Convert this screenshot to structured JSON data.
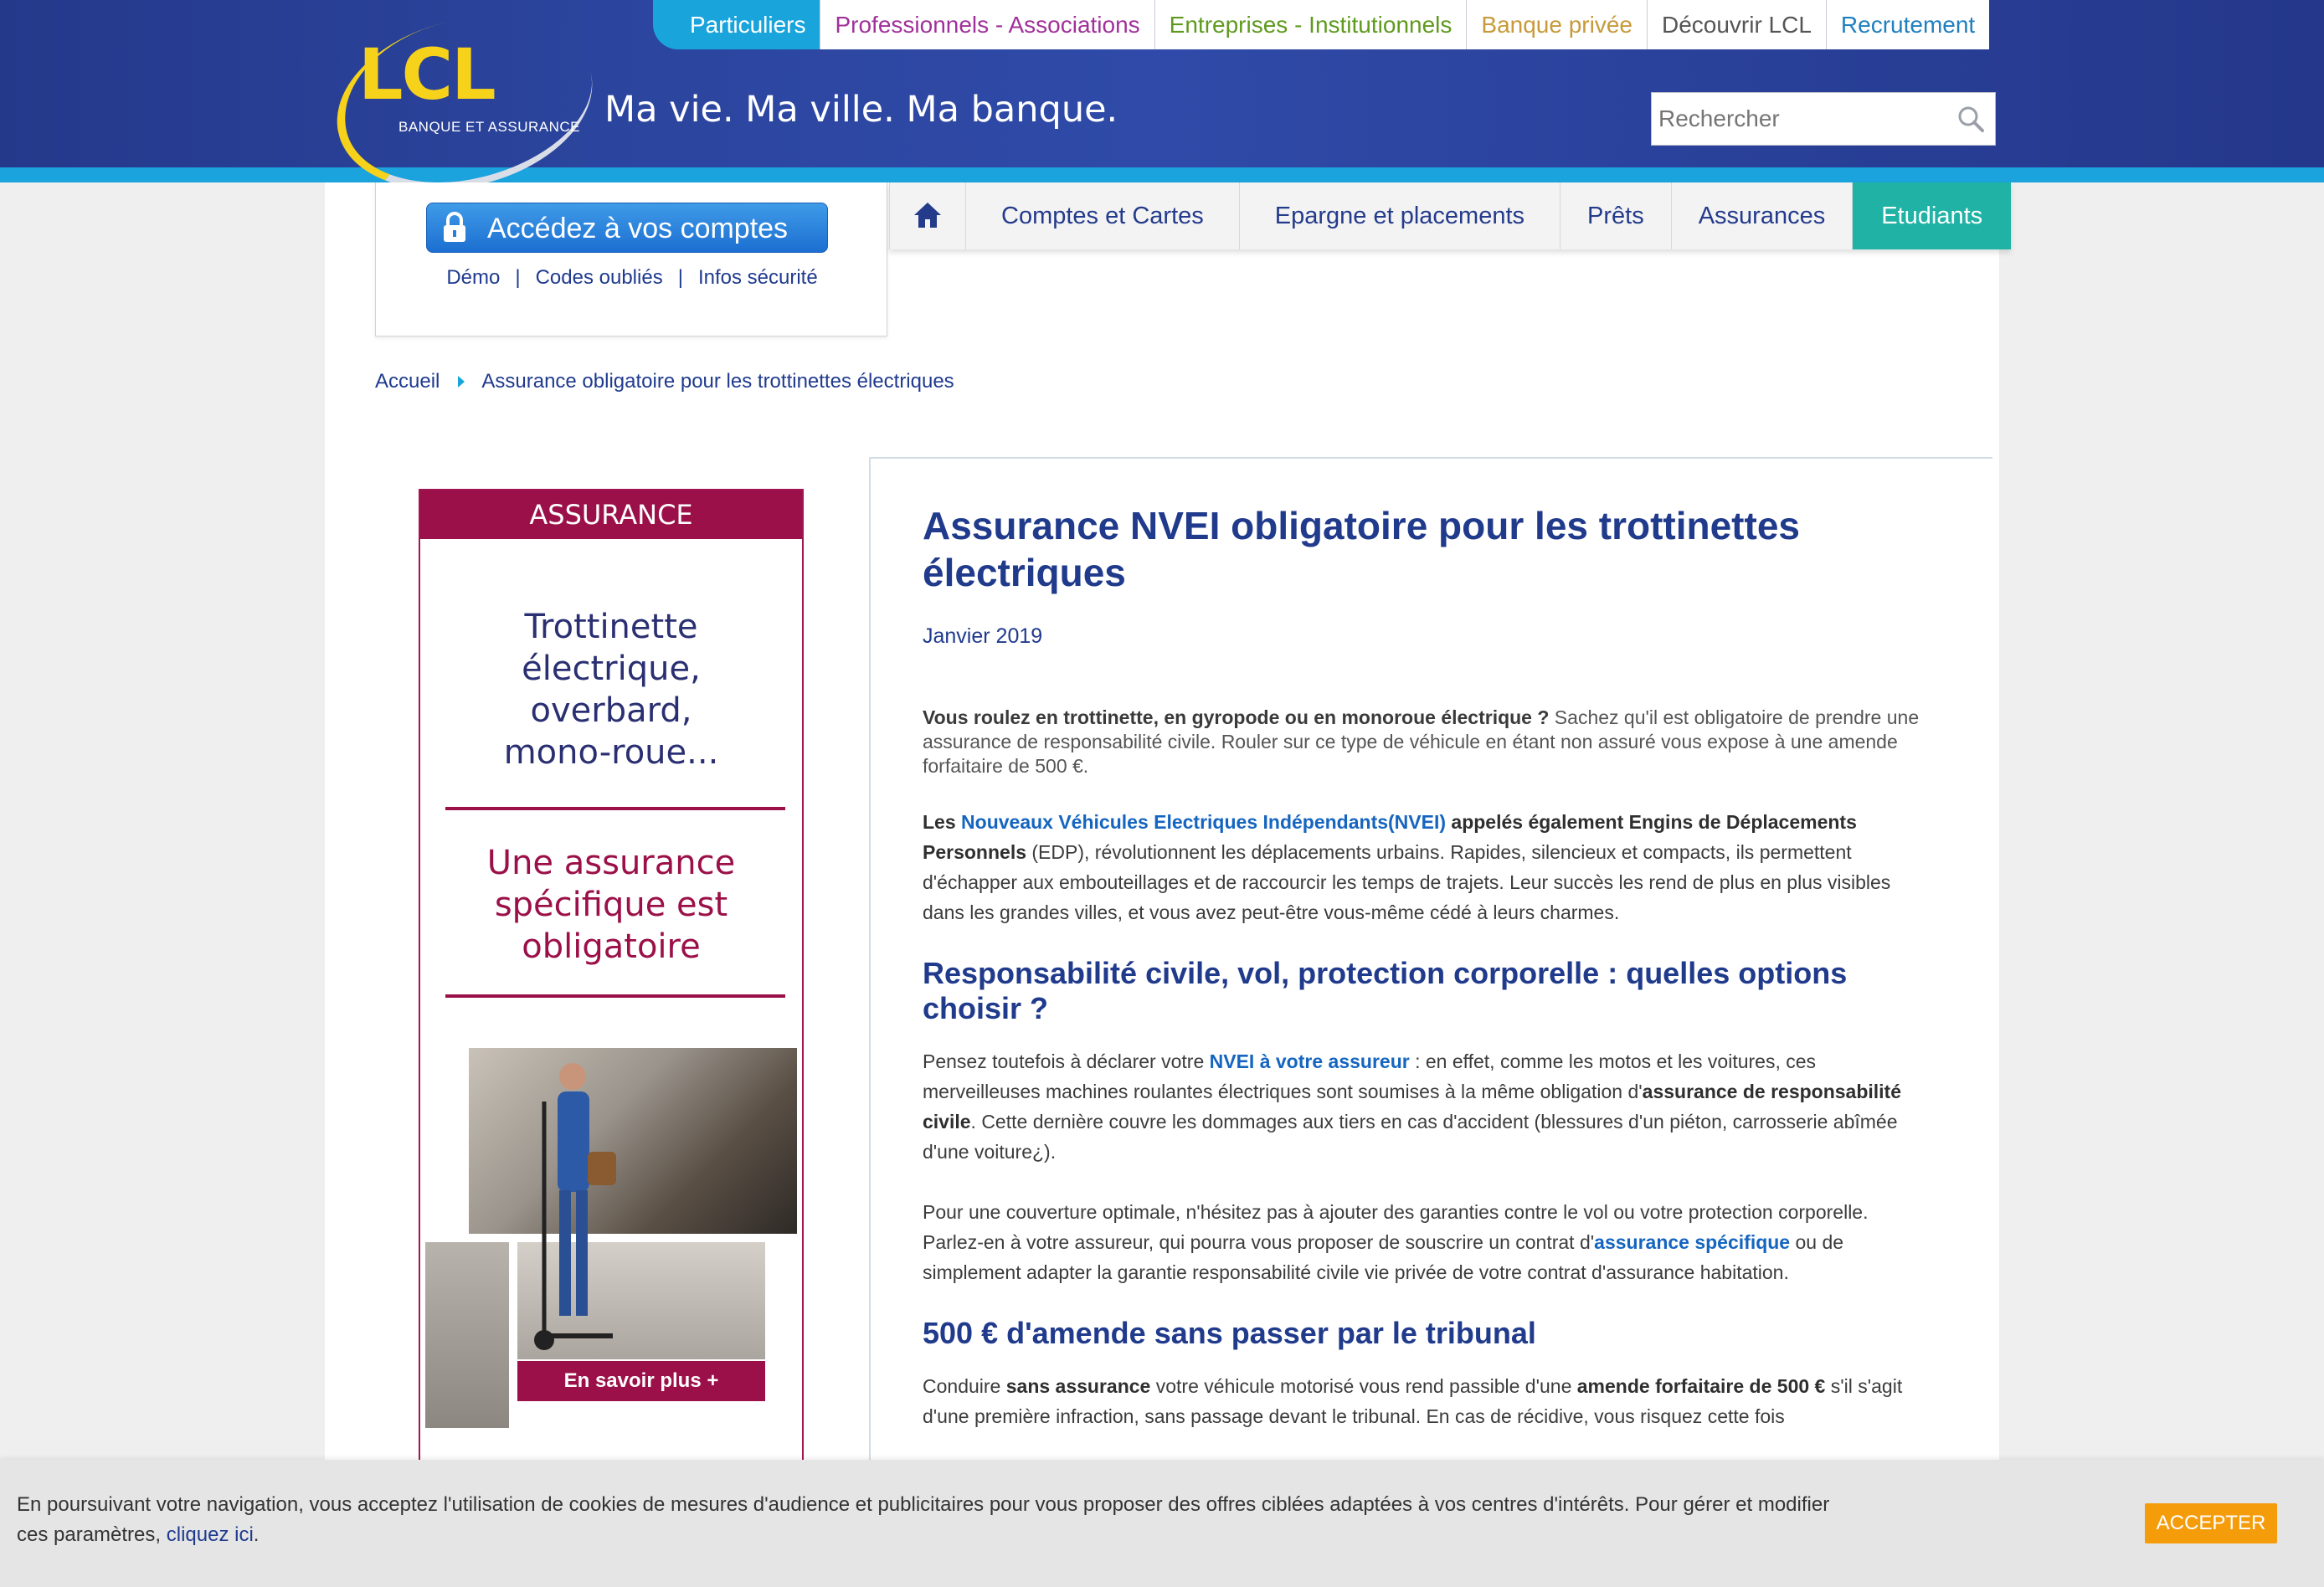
{
  "brand": {
    "logo_text": "LCL",
    "logo_sub": "BANQUE ET ASSURANCE",
    "tagline": "Ma vie. Ma ville. Ma banque.",
    "accent": "#19a4dc",
    "header_blue": "#2c46a0"
  },
  "topnav": [
    {
      "label": "Particuliers",
      "color": "#ffffff"
    },
    {
      "label": "Professionnels - Associations",
      "color": "#a0319a"
    },
    {
      "label": "Entreprises - Institutionnels",
      "color": "#5f9a1f"
    },
    {
      "label": "Banque privée",
      "color": "#c79a3a"
    },
    {
      "label": "Découvrir LCL",
      "color": "#555555"
    },
    {
      "label": "Recrutement",
      "color": "#1f7fbf"
    }
  ],
  "search": {
    "placeholder": "Rechercher",
    "icon": "search-icon"
  },
  "login": {
    "button": "Accédez à vos comptes",
    "icon": "lock-icon",
    "links": [
      "Démo",
      "Codes oubliés",
      "Infos sécurité"
    ]
  },
  "mainnav": {
    "home_icon": "home-icon",
    "items": [
      "Comptes et Cartes",
      "Epargne et placements",
      "Prêts",
      "Assurances",
      "Etudiants"
    ],
    "active": "Etudiants",
    "active_color": "#20b2a5"
  },
  "breadcrumb": [
    "Accueil",
    "Assurance obligatoire pour les trottinettes électriques"
  ],
  "ad": {
    "header": "ASSURANCE",
    "title_lines": [
      "Trottinette",
      "électrique,",
      "overbard,",
      "mono-roue..."
    ],
    "subtitle_lines": [
      "Une assurance",
      "spécifique est",
      "obligatoire"
    ],
    "cta": "En savoir plus +",
    "color": "#9b1048"
  },
  "article": {
    "title": "Assurance NVEI obligatoire pour les trottinettes électriques",
    "date": "Janvier 2019",
    "intro_bold": "Vous roulez en trottinette, en gyropode ou en monoroue électrique ?",
    "intro_rest": " Sachez qu'il est obligatoire de prendre une assurance de responsabilité civile. Rouler sur ce type de véhicule en étant non assuré vous expose à une amende forfaitaire de 500 €.",
    "p1_a": "Les ",
    "p1_link": "Nouveaux Véhicules Electriques Indépendants(NVEI)",
    "p1_bold": " appelés également Engins de Déplacements Personnels",
    "p1_rest": " (EDP), révolutionnent les déplacements urbains. Rapides, silencieux et compacts, ils permettent d'échapper aux embouteillages et de raccourcir les temps de trajets. Leur succès les rend de plus en plus visibles dans les grandes villes, et vous avez peut-être vous-même cédé à leurs charmes.",
    "h2_1": "Responsabilité civile, vol, protection corporelle : quelles options choisir ?",
    "p2_a": "Pensez toutefois à déclarer votre ",
    "p2_link": "NVEI à votre assureur",
    "p2_b": " : en effet, comme les motos et les voitures, ces merveilleuses machines roulantes électriques sont soumises à la même obligation d'",
    "p2_bold": "assurance de responsabilité civile",
    "p2_c": ". Cette dernière couvre les dommages aux tiers en cas d'accident (blessures d'un piéton, carrosserie abîmée d'une voiture¿).",
    "p3_a": "Pour une couverture optimale, n'hésitez pas à ajouter des garanties contre le vol ou votre protection corporelle. Parlez-en à votre assureur, qui pourra vous proposer de souscrire un contrat d'",
    "p3_link": "assurance spécifique",
    "p3_b": " ou de simplement adapter la garantie responsabilité civile vie privée de votre contrat d'assurance habitation.",
    "h2_2": "500 € d'amende sans passer par le tribunal",
    "p4_a": "Conduire ",
    "p4_bold1": "sans assurance",
    "p4_b": " votre véhicule motorisé vous rend passible d'une ",
    "p4_bold2": "amende forfaitaire de 500 €",
    "p4_c": " s'il s'agit d'une première infraction, sans passage devant le tribunal. En cas de récidive, vous risquez cette fois"
  },
  "cookie": {
    "text": "En poursuivant votre navigation, vous acceptez l'utilisation de cookies de mesures d'audience et publicitaires pour vous proposer des offres ciblées adaptées à vos centres d'intérêts. Pour gérer et modifier ces paramètres, ",
    "link": "cliquez ici",
    "end": ".",
    "button": "ACCEPTER",
    "button_color": "#f59c0b"
  }
}
